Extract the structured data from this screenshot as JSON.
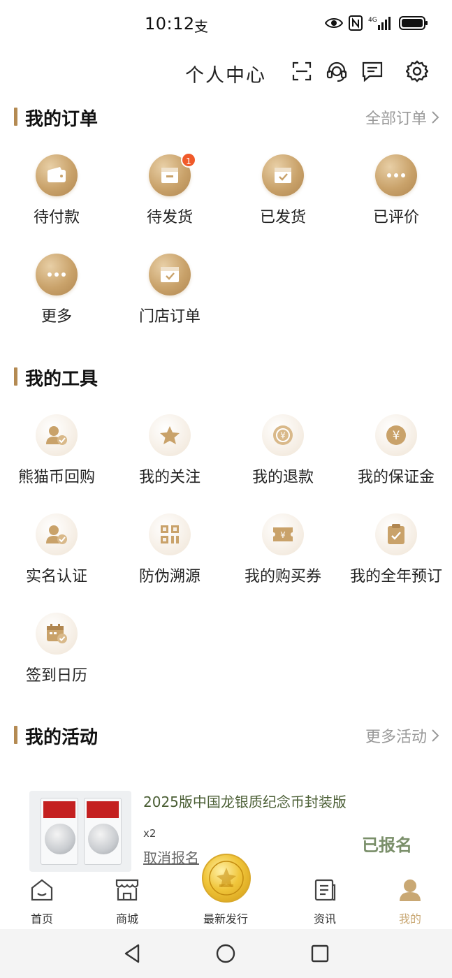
{
  "status_bar": {
    "time": "10:12",
    "extra_glyph": "支",
    "icons": [
      "eye-icon",
      "nfc-icon",
      "signal-4g-icon",
      "battery-icon"
    ],
    "network_label": "4G"
  },
  "header": {
    "title": "个人中心",
    "icons": [
      "scan-icon",
      "headset-icon",
      "message-icon",
      "settings-icon"
    ]
  },
  "orders": {
    "title": "我的订单",
    "link": "全部订单",
    "items": [
      {
        "label": "待付款",
        "icon": "wallet-icon",
        "badge": ""
      },
      {
        "label": "待发货",
        "icon": "package-icon",
        "badge": "1"
      },
      {
        "label": "已发货",
        "icon": "shipped-box-icon",
        "badge": ""
      },
      {
        "label": "已评价",
        "icon": "more-dots-icon",
        "badge": ""
      },
      {
        "label": "更多",
        "icon": "more-dots-icon",
        "badge": ""
      },
      {
        "label": "门店订单",
        "icon": "store-order-icon",
        "badge": ""
      }
    ]
  },
  "tools": {
    "title": "我的工具",
    "items": [
      {
        "label": "熊猫币回购",
        "icon": "user-check-icon"
      },
      {
        "label": "我的关注",
        "icon": "star-icon"
      },
      {
        "label": "我的退款",
        "icon": "refund-icon"
      },
      {
        "label": "我的保证金",
        "icon": "yen-coin-icon"
      },
      {
        "label": "实名认证",
        "icon": "user-verified-icon"
      },
      {
        "label": "防伪溯源",
        "icon": "qr-code-icon"
      },
      {
        "label": "我的购买券",
        "icon": "coupon-icon"
      },
      {
        "label": "我的全年预订",
        "icon": "clipboard-check-icon"
      },
      {
        "label": "签到日历",
        "icon": "calendar-check-icon"
      }
    ]
  },
  "activities": {
    "title": "我的活动",
    "link": "更多活动",
    "card": {
      "title": "2025版中国龙银质纪念币封装版",
      "quantity": "x2",
      "cancel": "取消报名",
      "status": "已报名"
    }
  },
  "bottom_nav": {
    "items": [
      {
        "label": "首页",
        "icon": "home-icon",
        "active": false
      },
      {
        "label": "商城",
        "icon": "shop-icon",
        "active": false
      },
      {
        "label": "最新发行",
        "icon": "gold-coin-icon",
        "active": false
      },
      {
        "label": "资讯",
        "icon": "news-icon",
        "active": false
      },
      {
        "label": "我的",
        "icon": "profile-icon",
        "active": true
      }
    ],
    "active_color": "#c9a874"
  },
  "colors": {
    "accent_gold": "#b48a52",
    "badge_red": "#f05a2a",
    "activity_status": "#7a8f6a"
  }
}
